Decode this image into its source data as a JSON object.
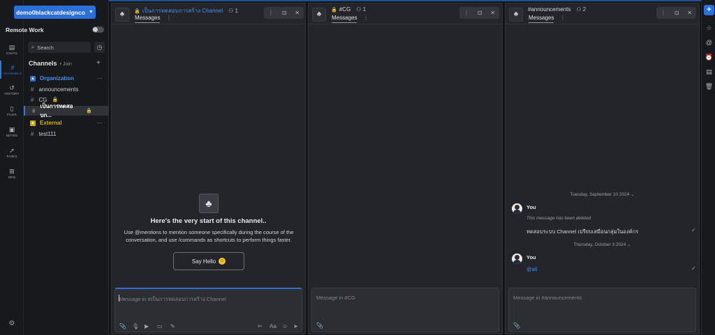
{
  "workspace": {
    "name": "demo0blackcatdesignco",
    "team": "Remote Work"
  },
  "rail": {
    "items": [
      {
        "label": "CHATS",
        "icon": "chat-icon",
        "glyph": "▤"
      },
      {
        "label": "CHANNELS",
        "icon": "hash-icon",
        "glyph": "#"
      },
      {
        "label": "HISTORY",
        "icon": "history-icon",
        "glyph": "↺"
      },
      {
        "label": "FILES",
        "icon": "file-icon",
        "glyph": "▯"
      },
      {
        "label": "NOTES",
        "icon": "notes-icon",
        "glyph": "▣"
      },
      {
        "label": "TASKS",
        "icon": "rocket-icon",
        "glyph": "➚"
      },
      {
        "label": "ORG",
        "icon": "org-icon",
        "glyph": "⊞"
      }
    ],
    "active": "CHANNELS",
    "settings_glyph": "⚙"
  },
  "sidebar": {
    "search_placeholder": "Search",
    "search_glyph": "⌕",
    "history_glyph": "◷",
    "channels_title": "Channels",
    "channels_join": "• Join",
    "add_glyph": "+",
    "more_glyph": "···",
    "groups": [
      {
        "name": "Organization",
        "color": "#4a8fe8",
        "channels": [
          {
            "name": "announcements",
            "private": false,
            "active": false
          },
          {
            "name": "CG",
            "private": true,
            "active": false
          },
          {
            "name": "เป็นการทดสอบก...",
            "private": true,
            "active": true
          }
        ]
      },
      {
        "name": "External",
        "color": "#d4b312",
        "channels": [
          {
            "name": "test111",
            "private": false,
            "active": false
          }
        ]
      }
    ]
  },
  "panes": [
    {
      "title": "เป็นการทดสอบการสร้าง Channel",
      "private": true,
      "members": "1",
      "tab": "Messages",
      "composer_placeholder": "Message in #เป็นการทดสอบการสร้าง Channel",
      "welcome": {
        "title": "Here's the very start of this channel..",
        "text": "Use @mentions to mention someone specifically during the course of the conversation, and use /commands as shortcuts to perform things faster.",
        "button": "Say Hello",
        "emoji": "☺"
      }
    },
    {
      "title": "#CG",
      "private": true,
      "members": "1",
      "tab": "Messages",
      "composer_placeholder": "Message in #CG"
    },
    {
      "title": "#announcements",
      "private": false,
      "members": "2",
      "tab": "Messages",
      "composer_placeholder": "Message in #announcements",
      "messages": [
        {
          "date": "Tuesday, September 10 2024 ⌄",
          "author": "You",
          "deleted_note": "This message has been deleted",
          "text": "ทดสอบระบบ Channel เปรียบเสมือนกลุ่มในองค์กร"
        },
        {
          "date": "Thursday, October 3 2024 ⌄",
          "author": "You",
          "text": "@all"
        }
      ]
    }
  ],
  "glyphs": {
    "lock": "🔒",
    "members": "⚇",
    "tab_more": "⋮",
    "pane_more": "⋮",
    "pane_popout": "⊡",
    "pane_close": "✕",
    "check": "✓",
    "org_avatar": "♣"
  },
  "composer_tools": {
    "left": [
      "📎",
      "🎙",
      "▶",
      "▭",
      "✎"
    ],
    "right": [
      "✂",
      "Aa",
      "☺",
      "➤"
    ]
  },
  "right_rail": {
    "plus": "+",
    "icons": [
      {
        "name": "star-icon",
        "glyph": "☆"
      },
      {
        "name": "mention-icon",
        "glyph": "@"
      },
      {
        "name": "alarm-icon",
        "glyph": "⏰"
      },
      {
        "name": "archive-icon",
        "glyph": "▤"
      },
      {
        "name": "trash-icon",
        "glyph": "🗑"
      }
    ]
  }
}
